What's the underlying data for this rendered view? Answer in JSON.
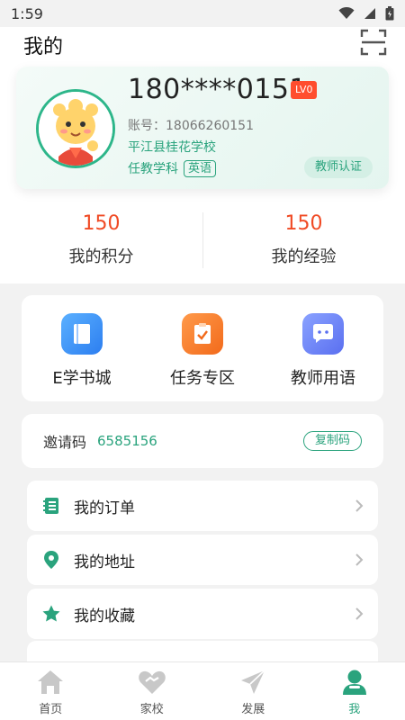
{
  "status_bar": {
    "time": "1:59",
    "icons": [
      "wifi-icon",
      "signal-icon",
      "battery-icon"
    ]
  },
  "header": {
    "title": "我的",
    "scan_icon": "scan-icon"
  },
  "profile": {
    "phone": "180****0151",
    "level": "LV0",
    "account": "账号：18066260151",
    "school": "平江县桂花学校",
    "subject_prefix": "任教学科",
    "subject": "英语",
    "verify_label": "教师认证"
  },
  "stats": [
    {
      "value": "150",
      "label": "我的积分"
    },
    {
      "value": "150",
      "label": "我的经验"
    }
  ],
  "quick_menu": [
    {
      "label": "E学书城",
      "icon": "book-icon"
    },
    {
      "label": "任务专区",
      "icon": "clipboard-check-icon"
    },
    {
      "label": "教师用语",
      "icon": "chat-icon"
    }
  ],
  "invite": {
    "label": "邀请码",
    "code": "6585156",
    "copy_label": "复制码"
  },
  "list": [
    {
      "label": "我的订单",
      "icon": "notebook-icon"
    },
    {
      "label": "我的地址",
      "icon": "location-pin-icon"
    },
    {
      "label": "我的收藏",
      "icon": "star-icon"
    }
  ],
  "tabs": [
    {
      "label": "首页",
      "icon": "home-icon"
    },
    {
      "label": "家校",
      "icon": "handshake-heart-icon"
    },
    {
      "label": "发展",
      "icon": "paper-plane-icon"
    },
    {
      "label": "我",
      "icon": "user-icon",
      "active": true
    }
  ],
  "colors": {
    "accent": "#2aa37d",
    "stat_value": "#f04a24",
    "badge": "#ff4d2e"
  }
}
